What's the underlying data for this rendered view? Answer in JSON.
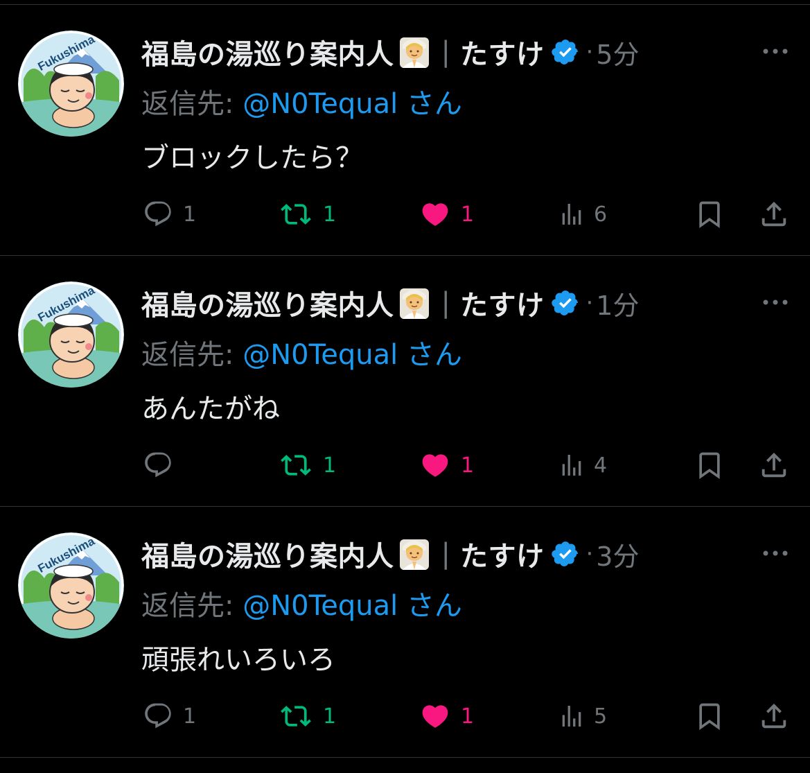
{
  "colors": {
    "background": "#000000",
    "text": "#e7e9ea",
    "muted": "#71767b",
    "link": "#1d9bf0",
    "repost_active": "#00ba7c",
    "like_active": "#f91880",
    "verified": "#1d9bf0",
    "divider": "#2f3336"
  },
  "tweets": [
    {
      "display_name": "福島の湯巡り案内人",
      "name_emoji": "person-in-steamy-room-emoji",
      "separator": "|",
      "sub_name": "たすけ",
      "verified_icon": "verified-badge-icon",
      "dot": "·",
      "time": "5分",
      "avatar_text": "Fukushima",
      "reply_label": "返信先:",
      "reply_handle": "@N0Tequal",
      "reply_suffix": "さん",
      "text": "ブロックしたら？",
      "replies": "1",
      "reposts": "1",
      "likes": "1",
      "views": "6"
    },
    {
      "display_name": "福島の湯巡り案内人",
      "name_emoji": "person-in-steamy-room-emoji",
      "separator": "|",
      "sub_name": "たすけ",
      "verified_icon": "verified-badge-icon",
      "dot": "·",
      "time": "1分",
      "avatar_text": "Fukushima",
      "reply_label": "返信先:",
      "reply_handle": "@N0Tequal",
      "reply_suffix": "さん",
      "text": "あんたがね",
      "replies": "",
      "reposts": "1",
      "likes": "1",
      "views": "4"
    },
    {
      "display_name": "福島の湯巡り案内人",
      "name_emoji": "person-in-steamy-room-emoji",
      "separator": "|",
      "sub_name": "たすけ",
      "verified_icon": "verified-badge-icon",
      "dot": "·",
      "time": "3分",
      "avatar_text": "Fukushima",
      "reply_label": "返信先:",
      "reply_handle": "@N0Tequal",
      "reply_suffix": "さん",
      "text": "頑張れいろいろ",
      "replies": "1",
      "reposts": "1",
      "likes": "1",
      "views": "5"
    }
  ]
}
